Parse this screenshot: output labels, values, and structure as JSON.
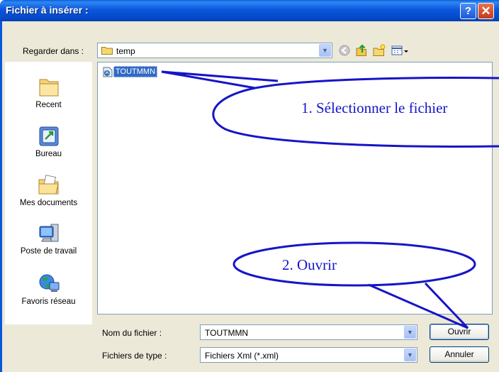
{
  "window": {
    "title": "Fichier à insérer :",
    "help_icon": "?",
    "close_icon": "✕"
  },
  "toolbar": {
    "look_in_label": "Regarder dans :",
    "look_in_value": "temp"
  },
  "places": [
    {
      "label": "Recent",
      "icon": "recent-folder-icon"
    },
    {
      "label": "Bureau",
      "icon": "desktop-icon"
    },
    {
      "label": "Mes documents",
      "icon": "my-documents-icon"
    },
    {
      "label": "Poste de travail",
      "icon": "my-computer-icon"
    },
    {
      "label": "Favoris réseau",
      "icon": "network-places-icon"
    }
  ],
  "files": [
    {
      "name": "TOUTMMN",
      "selected": true
    }
  ],
  "form": {
    "filename_label": "Nom du fichier :",
    "filename_value": "TOUTMMN",
    "filetype_label": "Fichiers de type :",
    "filetype_value": "Fichiers Xml (*.xml)",
    "open_label": "Ouvrir",
    "cancel_label": "Annuler"
  },
  "annotations": {
    "callout1": "1. Sélectionner le fichier",
    "callout2": "2. Ouvrir"
  },
  "colors": {
    "callout": "#1515c8",
    "selection": "#316ac5",
    "titlebar": "#0b57dc"
  }
}
